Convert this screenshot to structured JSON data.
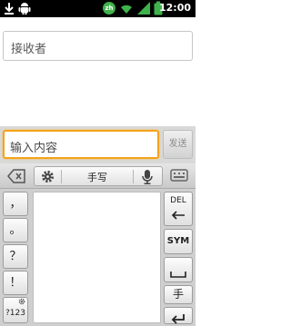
{
  "status_bar": {
    "time": "12:00",
    "input_method_badge": "zh",
    "icons": [
      "download-arrow-icon",
      "android-icon",
      "input-method-badge-icon",
      "wifi-icon",
      "signal-icon",
      "battery-icon"
    ]
  },
  "recipient": {
    "placeholder": "接收者"
  },
  "compose": {
    "placeholder": "输入内容",
    "send_label": "发送"
  },
  "keyboard": {
    "toolbar": {
      "handwriting_label": "手写",
      "icons": [
        "collapse-keyboard-icon",
        "settings-gear-icon",
        "microphone-icon",
        "keyboard-layout-icon"
      ]
    },
    "punctuation_keys": [
      "，",
      "。",
      "？",
      "！"
    ],
    "mode_key": "?123",
    "del_label": "DEL",
    "sym_label": "SYM",
    "hand_label": "手",
    "accent_color": "#f6a21c"
  }
}
